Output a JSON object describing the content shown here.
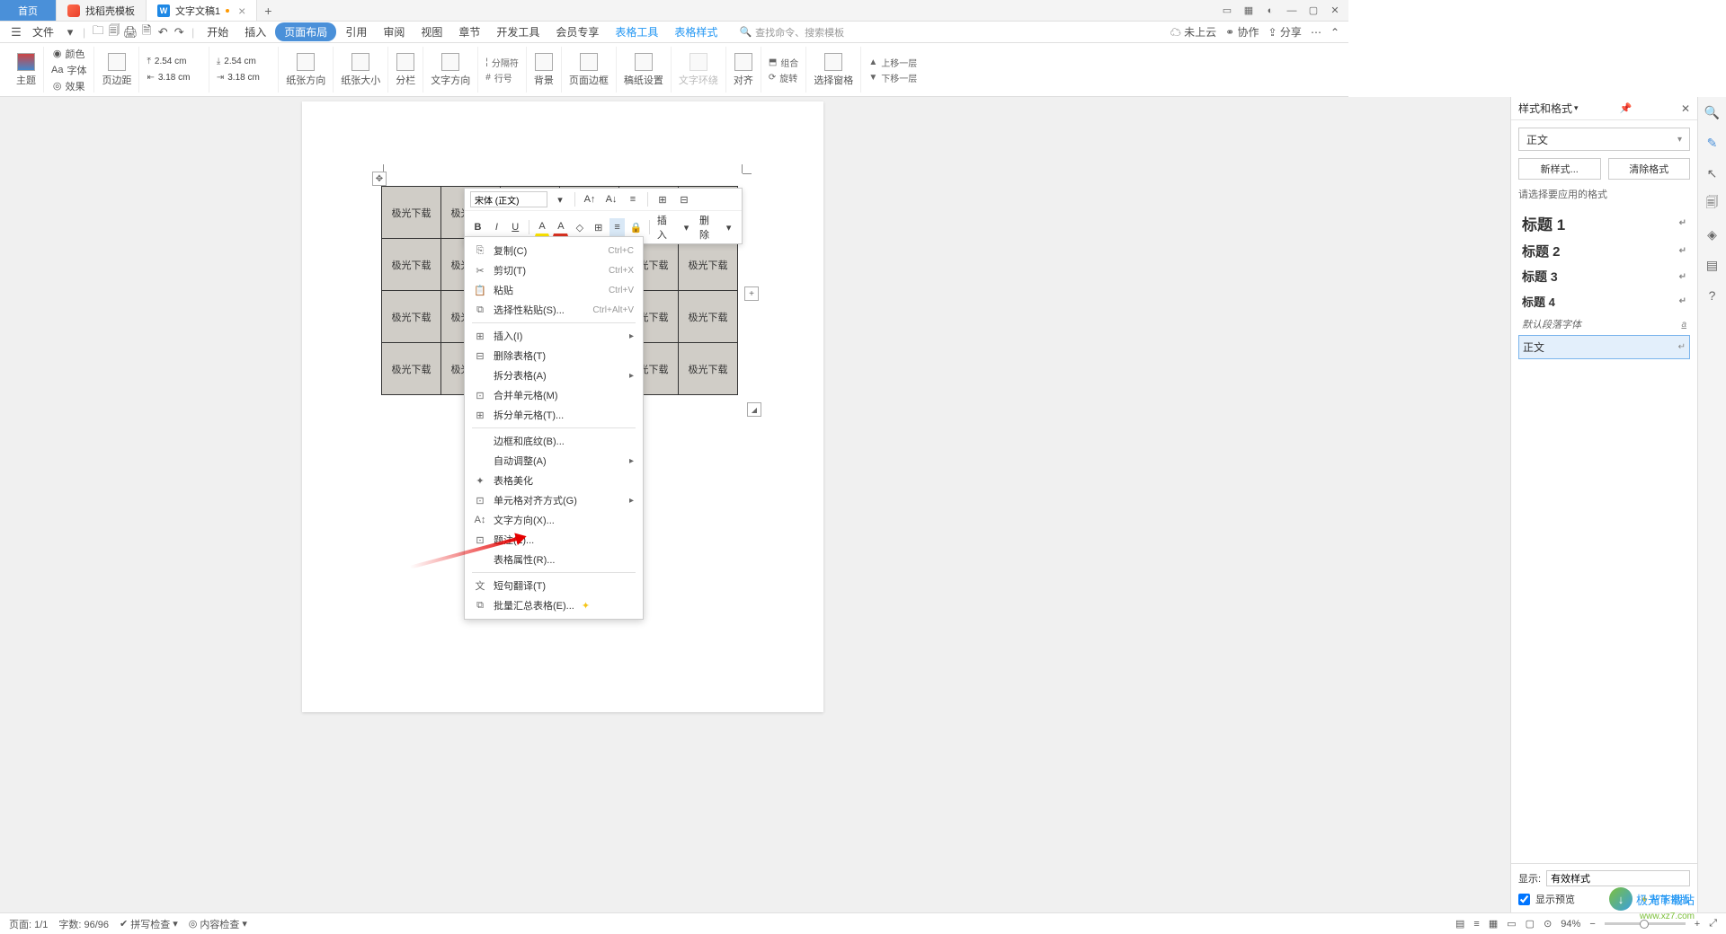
{
  "tabs": {
    "home": "首页",
    "t1": "找稻壳模板",
    "t2": "文字文稿1",
    "add": "+"
  },
  "file_menu": "文件",
  "main_menu": [
    "开始",
    "插入",
    "页面布局",
    "引用",
    "审阅",
    "视图",
    "章节",
    "开发工具",
    "会员专享",
    "表格工具",
    "表格样式"
  ],
  "search_placeholder": "查找命令、搜索模板",
  "top_right": {
    "cloud": "未上云",
    "coop": "协作",
    "share": "分享"
  },
  "ribbon": {
    "theme": "主题",
    "color": "颜色",
    "font": "字体",
    "effect": "效果",
    "margin": "页边距",
    "indent_top": "2.54 cm",
    "indent_bottom": "3.18 cm",
    "indent_top2": "2.54 cm",
    "indent_bottom2": "3.18 cm",
    "orient": "纸张方向",
    "size": "纸张大小",
    "columns": "分栏",
    "textdir": "文字方向",
    "breaks": "分隔符",
    "linenum": "行号",
    "bg": "背景",
    "border": "页面边框",
    "grid": "稿纸设置",
    "wrap": "文字环绕",
    "align": "对齐",
    "rotate": "旋转",
    "group": "组合",
    "selpane": "选择窗格",
    "forward": "上移一层",
    "backward": "下移一层"
  },
  "table_cell": "极光下载",
  "mini_toolbar": {
    "font": "宋体 (正文)",
    "insert": "插入",
    "delete": "删除"
  },
  "context_menu": {
    "copy": "复制(C)",
    "copy_sc": "Ctrl+C",
    "cut": "剪切(T)",
    "cut_sc": "Ctrl+X",
    "paste": "粘贴",
    "paste_sc": "Ctrl+V",
    "paste_special": "选择性粘贴(S)...",
    "ps_sc": "Ctrl+Alt+V",
    "insert": "插入(I)",
    "del_table": "删除表格(T)",
    "split_table": "拆分表格(A)",
    "merge_cell": "合并单元格(M)",
    "split_cell": "拆分单元格(T)...",
    "border_shade": "边框和底纹(B)...",
    "auto_fit": "自动调整(A)",
    "beautify": "表格美化",
    "cell_align": "单元格对齐方式(G)",
    "text_dir": "文字方向(X)...",
    "caption": "题注(Z)...",
    "table_prop": "表格属性(R)...",
    "translate": "短句翻译(T)",
    "batch_sum": "批量汇总表格(E)..."
  },
  "styles_panel": {
    "title": "样式和格式",
    "current": "正文",
    "new_style": "新样式...",
    "clear_fmt": "清除格式",
    "hint": "请选择要应用的格式",
    "list": [
      "标题 1",
      "标题 2",
      "标题 3",
      "标题 4",
      "默认段落字体",
      "正文"
    ],
    "show_label": "显示:",
    "show_value": "有效样式",
    "preview": "显示预览",
    "smart": "智能排版"
  },
  "status": {
    "page": "页面: 1/1",
    "chars": "字数: 96/96",
    "spell": "拼写检查",
    "content": "内容检查",
    "zoom": "94%"
  },
  "watermark": {
    "t1": "极光下载站",
    "t2": "www.xz7.com"
  }
}
